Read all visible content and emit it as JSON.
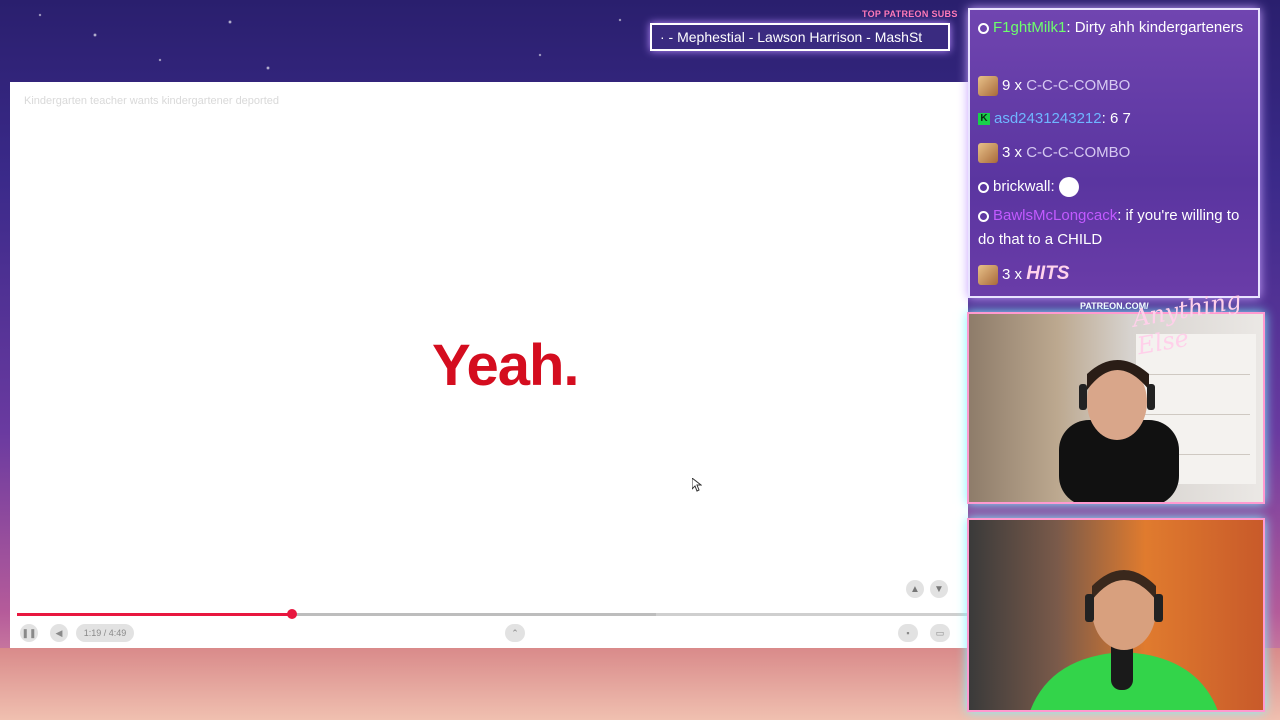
{
  "overlay": {
    "subs_label": "TOP PATREON SUBS",
    "subs_ticker": "· - Mephestial - Lawson Harrison - MashSt",
    "patreon_tag": "PATREON.COM/",
    "signature": "Anything Else"
  },
  "player": {
    "video_title": "Kindergarten teacher wants kindergartener deported",
    "caption": "Yeah.",
    "time_display": "1:19 / 4:49",
    "progress_fraction": 0.289,
    "buffered_fraction": 0.672,
    "accent_color": "#e8173f",
    "caption_color": "#d40d1f"
  },
  "chat": {
    "messages": [
      {
        "badge": "prime",
        "user": "F1ghtMilk1",
        "user_color": "#6dff6d",
        "text": ": Dirty ahh kindergarteners"
      },
      {
        "emote": "combo",
        "count": "9 x",
        "text": "C-C-C-COMBO"
      },
      {
        "badge": "k",
        "user": "asd2431243212",
        "user_color": "#6fb6ff",
        "text": ": 6 7"
      },
      {
        "emote": "combo",
        "count": "3 x",
        "text": "C-C-C-COMBO"
      },
      {
        "badge": "prime",
        "user": "brickwall",
        "user_color": "#ffffff",
        "text": ":"
      },
      {
        "badge": "prime",
        "user": "BawlsMcLongcack",
        "user_color": "#c25aff",
        "text": ": if you're willing to do that to a CHILD"
      },
      {
        "emote": "combo",
        "count": "3 x",
        "text": "HITS"
      }
    ]
  }
}
